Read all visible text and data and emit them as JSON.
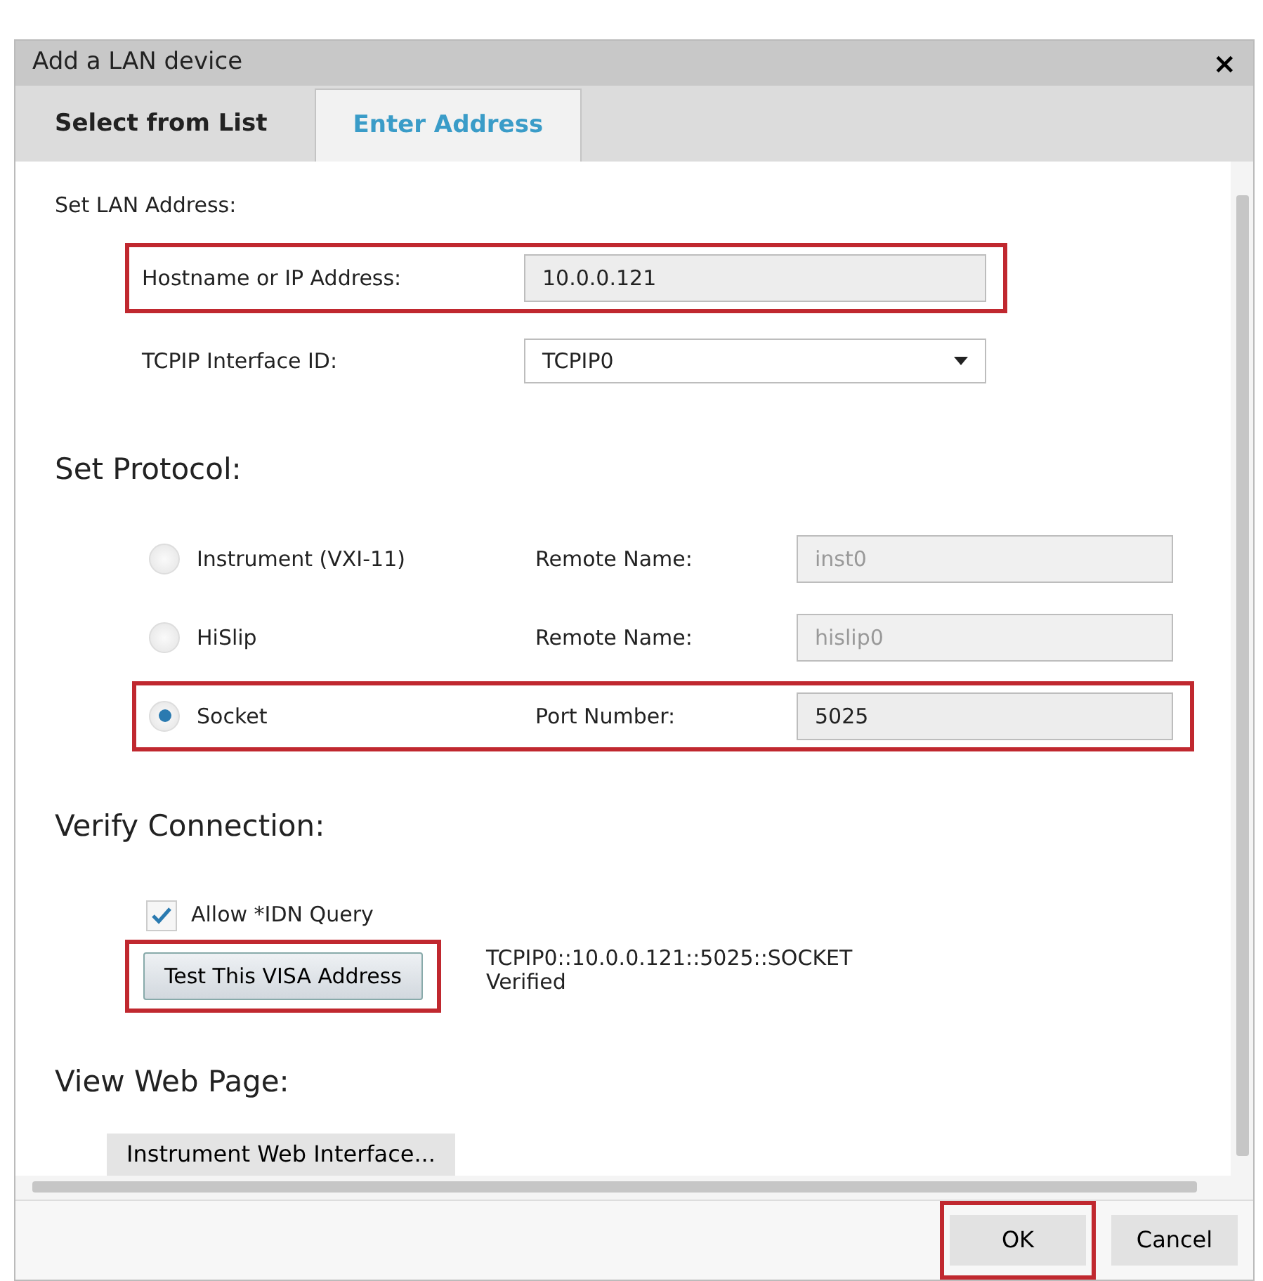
{
  "dialog": {
    "title": "Add a LAN device",
    "close": "×"
  },
  "tabs": [
    {
      "label": "Select from List",
      "selected": false
    },
    {
      "label": "Enter Address",
      "selected": true
    }
  ],
  "lan": {
    "heading": "Set LAN Address:",
    "fields": [
      {
        "kind": "text",
        "label": "Hostname or IP Address:",
        "value": "10.0.0.121",
        "highlighted": true
      },
      {
        "kind": "select",
        "label": "TCPIP Interface ID:",
        "value": "TCPIP0",
        "highlighted": false
      }
    ]
  },
  "protocol": {
    "heading": "Set Protocol:",
    "options": [
      {
        "label": "Instrument (VXI-11)",
        "selected": false,
        "field_label": "Remote Name:",
        "field_value": "inst0",
        "disabled": true,
        "highlighted": false
      },
      {
        "label": "HiSlip",
        "selected": false,
        "field_label": "Remote Name:",
        "field_value": "hislip0",
        "disabled": true,
        "highlighted": false
      },
      {
        "label": "Socket",
        "selected": true,
        "field_label": "Port Number:",
        "field_value": "5025",
        "disabled": false,
        "highlighted": true
      }
    ]
  },
  "verify": {
    "heading": "Verify Connection:",
    "allow_idn": {
      "label": "Allow *IDN Query",
      "checked": true
    },
    "test_button": {
      "label": "Test This VISA Address",
      "highlighted": true
    },
    "result": [
      "TCPIP0::10.0.0.121::5025::SOCKET",
      "Verified"
    ]
  },
  "web": {
    "heading": "View Web Page:",
    "button": "Instrument Web Interface..."
  },
  "footer": {
    "buttons": [
      {
        "label": "OK",
        "highlighted": true
      },
      {
        "label": "Cancel",
        "highlighted": false
      }
    ]
  }
}
